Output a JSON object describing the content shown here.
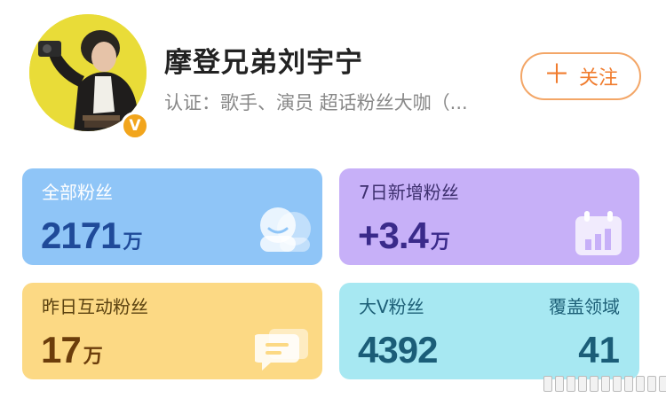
{
  "profile": {
    "name": "摩登兄弟刘宇宁",
    "certification": "认证：歌手、演员 超话粉丝大咖（...",
    "badge": "V",
    "follow_label": "关注",
    "follow_icon": "plus-icon"
  },
  "stats": {
    "total_fans": {
      "label": "全部粉丝",
      "value": "2171",
      "unit": "万"
    },
    "new_fans_7d": {
      "label": "7日新增粉丝",
      "value": "+3.4",
      "unit": "万"
    },
    "interactive_fans_yesterday": {
      "label": "昨日互动粉丝",
      "value": "17",
      "unit": "万"
    },
    "big_v_fans": {
      "label": "大V粉丝",
      "value": "4392",
      "coverage_label": "覆盖领域",
      "coverage_value": "41"
    }
  },
  "colors": {
    "follow_accent": "#f07c2e",
    "card_blue": "#8fc5f7",
    "card_purple": "#c7b0f8",
    "card_yellow": "#fcd984",
    "card_cyan": "#a7e8f2",
    "badge_orange": "#f2a51c"
  }
}
